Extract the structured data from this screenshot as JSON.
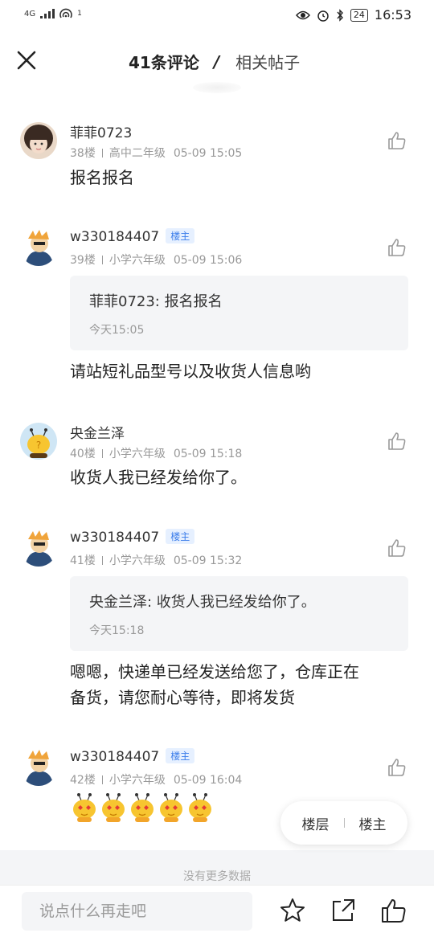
{
  "status_bar": {
    "network": "4G",
    "wifi_sup": "1",
    "battery": "24",
    "time": "16:53"
  },
  "header": {
    "active_tab": "41条评论",
    "separator": "/",
    "inactive_tab": "相关帖子"
  },
  "comments": [
    {
      "username": "菲菲0723",
      "badge": "",
      "floor": "38楼",
      "grade": "高中二年级",
      "time": "05-09 15:05",
      "text": "报名报名"
    },
    {
      "username": "w330184407",
      "badge": "楼主",
      "floor": "39楼",
      "grade": "小学六年级",
      "time": "05-09 15:06",
      "quote_text": "菲菲0723: 报名报名",
      "quote_time": "今天15:05",
      "text": "请站短礼品型号以及收货人信息哟"
    },
    {
      "username": "央金兰泽",
      "badge": "",
      "floor": "40楼",
      "grade": "小学六年级",
      "time": "05-09 15:18",
      "text": "收货人我已经发给你了。"
    },
    {
      "username": "w330184407",
      "badge": "楼主",
      "floor": "41楼",
      "grade": "小学六年级",
      "time": "05-09 15:32",
      "quote_text": "央金兰泽: 收货人我已经发给你了。",
      "quote_time": "今天15:18",
      "text_line1": "嗯嗯，快递单已经发送给您了，仓库正在",
      "text_line2": "备货，请您耐心等待，即将发货"
    },
    {
      "username": "w330184407",
      "badge": "楼主",
      "floor": "42楼",
      "grade": "小学六年级",
      "time": "05-09 16:04",
      "emoji_count": 5
    }
  ],
  "floating": {
    "floor_label": "楼层",
    "owner_label": "楼主"
  },
  "footer": {
    "no_more": "没有更多数据"
  },
  "bottom_bar": {
    "placeholder": "说点什么再走吧",
    "icons": [
      "star-icon",
      "share-icon",
      "thumbs-up-icon"
    ]
  }
}
